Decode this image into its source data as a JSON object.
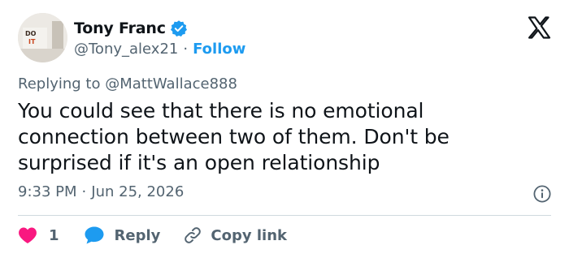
{
  "author": {
    "display_name": "Tony Franc",
    "handle": "@Tony_alex21",
    "separator": "·",
    "follow_label": "Follow",
    "avatar_sign_lines": [
      "DO",
      "IT"
    ]
  },
  "reply_context": {
    "prefix": "Replying to",
    "mention": "@MattWallace888"
  },
  "tweet": {
    "text": "You could see that there is no emotional connection between two of them. Don't be surprised if it's an open relationship",
    "time": "9:33 PM",
    "separator": "·",
    "date": "Jun 25, 2026"
  },
  "actions": {
    "like_count": "1",
    "reply_label": "Reply",
    "copy_link_label": "Copy link"
  },
  "colors": {
    "accent": "#1d9bf0",
    "like": "#f91880",
    "text": "#0f1419",
    "secondary": "#536471"
  },
  "icons": [
    "verified-badge-icon",
    "x-logo-icon",
    "info-icon",
    "heart-icon",
    "reply-bubble-icon",
    "link-icon"
  ]
}
